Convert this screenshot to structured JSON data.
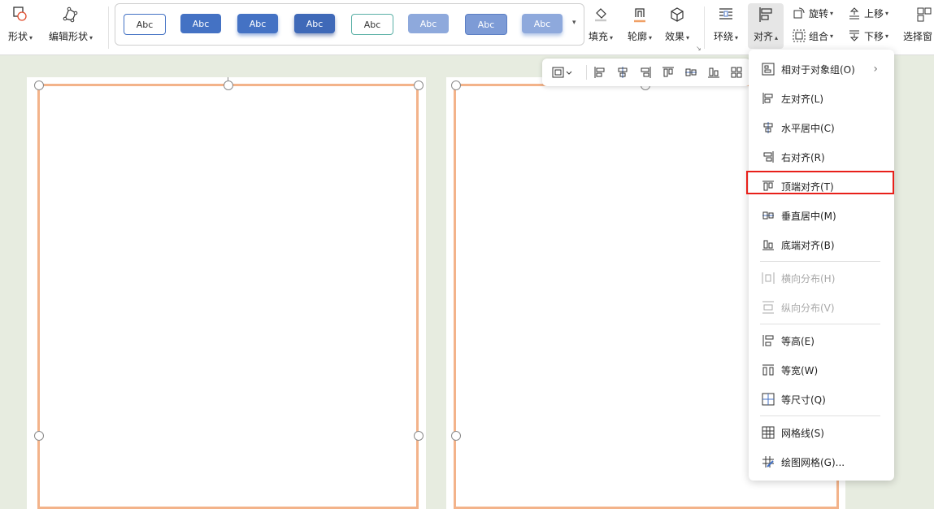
{
  "ribbon": {
    "shape_label": "形状",
    "edit_shape_label": "编辑形状",
    "styles": [
      "Abc",
      "Abc",
      "Abc",
      "Abc",
      "Abc",
      "Abc",
      "Abc",
      "Abc"
    ],
    "fill_label": "填充",
    "outline_label": "轮廓",
    "effect_label": "效果",
    "wrap_label": "环绕",
    "align_label": "对齐",
    "rotate_label": "旋转",
    "group_label": "组合",
    "bring_forward_label": "上移",
    "send_backward_label": "下移",
    "selection_pane_label": "选择窗"
  },
  "colors": {
    "accent": "#4472c4",
    "frame_orange": "#f3b38a",
    "highlight_red": "#e8201a",
    "canvas_bg": "#e7ece0"
  },
  "menu": {
    "items": [
      {
        "label": "相对于对象组(O)",
        "icon": "relative-group-icon"
      },
      {
        "label": "左对齐(L)",
        "icon": "align-left-icon"
      },
      {
        "label": "水平居中(C)",
        "icon": "align-center-horizontal-icon"
      },
      {
        "label": "右对齐(R)",
        "icon": "align-right-icon"
      },
      {
        "label": "顶端对齐(T)",
        "icon": "align-top-icon"
      },
      {
        "label": "垂直居中(M)",
        "icon": "align-middle-vertical-icon"
      },
      {
        "label": "底端对齐(B)",
        "icon": "align-bottom-icon"
      },
      {
        "label": "横向分布(H)",
        "icon": "distribute-horizontal-icon"
      },
      {
        "label": "纵向分布(V)",
        "icon": "distribute-vertical-icon"
      },
      {
        "label": "等高(E)",
        "icon": "same-height-icon"
      },
      {
        "label": "等宽(W)",
        "icon": "same-width-icon"
      },
      {
        "label": "等尺寸(Q)",
        "icon": "same-size-icon"
      },
      {
        "label": "网格线(S)",
        "icon": "gridlines-icon"
      },
      {
        "label": "绘图网格(G)...",
        "icon": "drawing-grid-icon"
      }
    ]
  }
}
